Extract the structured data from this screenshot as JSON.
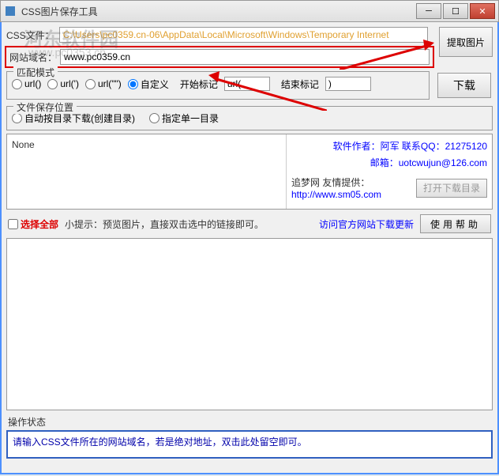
{
  "title": "CSS图片保存工具",
  "watermark": "河东软件园",
  "watermark_sub": "www.pc0353.cn",
  "css_file": {
    "label": "CSS文件：",
    "path": "C:\\Users\\pc0359.cn-06\\AppData\\Local\\Microsoft\\Windows\\Temporary Internet"
  },
  "extract_btn": "提取图片",
  "domain": {
    "label": "网站域名：",
    "value": "www.pc0359.cn"
  },
  "match_mode": {
    "legend": "匹配模式",
    "options": [
      "url()",
      "url(')",
      "url(\"\")",
      "自定义"
    ],
    "start_label": "开始标记",
    "start_value": "url(",
    "end_label": "结束标记",
    "end_value": ")"
  },
  "download_btn": "下载",
  "save_location": {
    "legend": "文件保存位置",
    "opt1": "自动按目录下载(创建目录)",
    "opt2": "指定单一目录"
  },
  "preview": {
    "none_text": "None",
    "author": "软件作者：阿军 联系QQ：21275120",
    "email": "邮箱：uotcwujun@126.com",
    "dream_label": "追梦网 友情提供：",
    "dream_url": "http://www.sm05.com",
    "open_dir": "打开下载目录"
  },
  "select_all": "选择全部",
  "hint": "小提示：预览图片，直接双击选中的链接即可。",
  "visit_link": "访问官方网站下载更新",
  "help_btn": "使用帮助",
  "status": {
    "label": "操作状态",
    "text": "请输入CSS文件所在的网站域名，若是绝对地址，双击此处留空即可。"
  }
}
